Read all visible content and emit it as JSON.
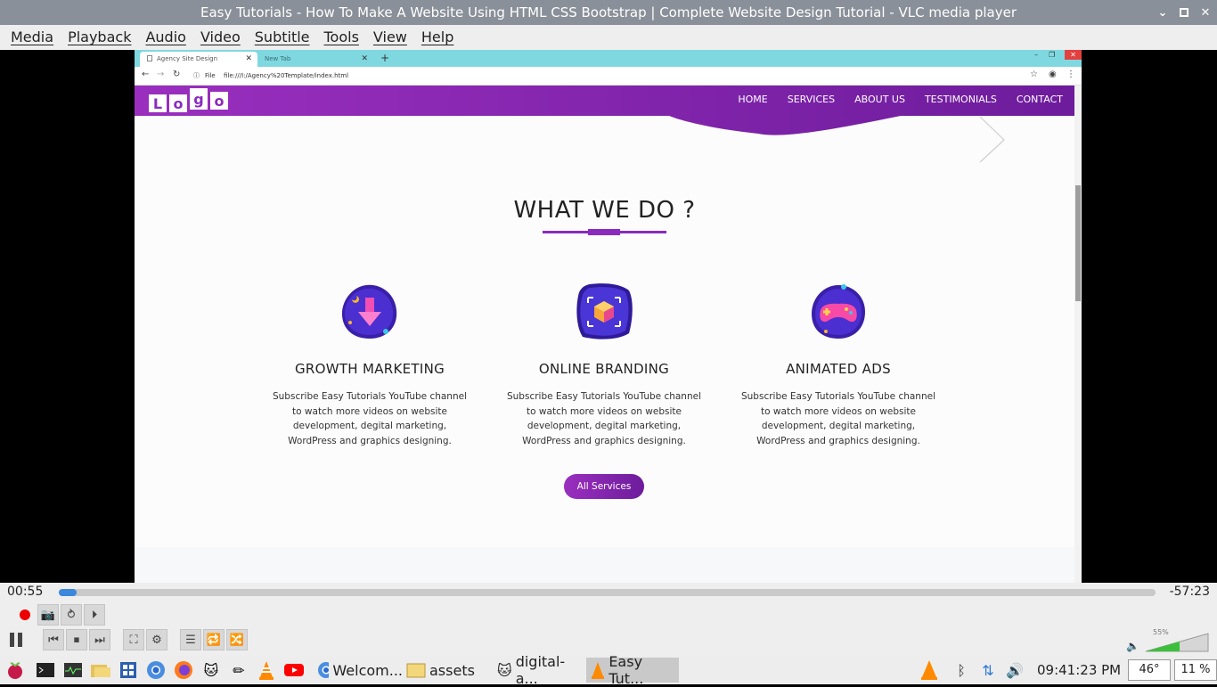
{
  "window": {
    "title": "Easy Tutorials - How To Make A Website Using HTML CSS Bootstrap | Complete Website Design Tutorial - VLC media player"
  },
  "menu": [
    "Media",
    "Playback",
    "Audio",
    "Video",
    "Subtitle",
    "Tools",
    "View",
    "Help"
  ],
  "browser": {
    "tabs": [
      {
        "label": "Agency Site Design",
        "active": true
      },
      {
        "label": "New Tab",
        "active": false
      }
    ],
    "url_scheme": "File",
    "url": "file:///I:/Agency%20Template/index.html"
  },
  "site": {
    "logo_letters": [
      "L",
      "o",
      "g",
      "o"
    ],
    "nav": [
      "HOME",
      "SERVICES",
      "ABOUT US",
      "TESTIMONIALS",
      "CONTACT"
    ],
    "section_title": "WHAT WE DO ?",
    "services": [
      {
        "title": "GROWTH MARKETING",
        "icon": "growth-arrow-icon",
        "text": "Subscribe Easy Tutorials YouTube channel to watch more videos on website development, degital marketing, WordPress and graphics designing."
      },
      {
        "title": "ONLINE BRANDING",
        "icon": "branding-cube-icon",
        "text": "Subscribe Easy Tutorials YouTube channel to watch more videos on website development, degital marketing, WordPress and graphics designing."
      },
      {
        "title": "ANIMATED ADS",
        "icon": "gamepad-icon",
        "text": "Subscribe Easy Tutorials YouTube channel to watch more videos on website development, degital marketing, WordPress and graphics designing."
      }
    ],
    "button": "All Services",
    "accent": "#8a2bbd"
  },
  "player": {
    "elapsed": "00:55",
    "remaining": "-57:23",
    "progress_fraction": 0.016,
    "volume": "55%"
  },
  "taskbar": {
    "tasks": [
      {
        "label": "Welcom...",
        "icon": "chromium-icon"
      },
      {
        "label": "assets",
        "icon": "folder-icon"
      },
      {
        "label": "digital-a...",
        "icon": "image-viewer-icon"
      },
      {
        "label": "Easy Tut...",
        "icon": "vlc-icon"
      }
    ],
    "clock": "09:41:23 PM",
    "temp": "46°",
    "cpu": "11 %"
  }
}
